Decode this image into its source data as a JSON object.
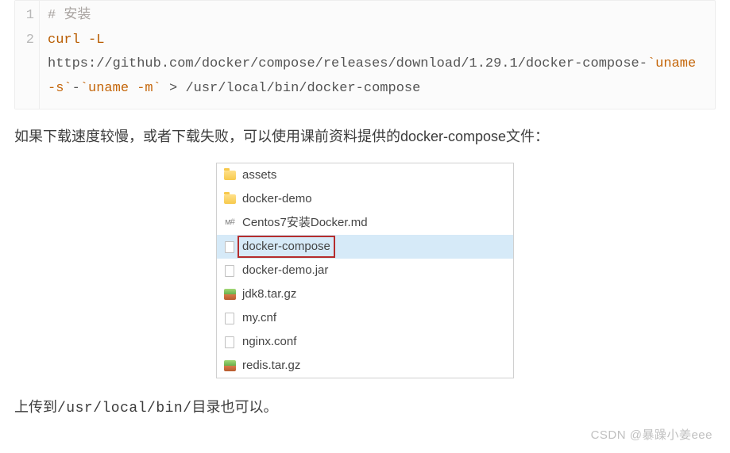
{
  "code": {
    "line_nums": [
      "1",
      "2"
    ],
    "comment": "# 安装",
    "cmd": "curl",
    "flag": "-L",
    "url": "https://github.com/docker/compose/releases/download/1.29.1/docker-compose-",
    "sub1": "`uname -s`",
    "dash": "-",
    "sub2": "`uname -m`",
    "redir": " > /usr/local/bin/docker-compose"
  },
  "para1": "如果下载速度较慢，或者下载失败，可以使用课前资料提供的docker-compose文件：",
  "files": {
    "items": [
      {
        "icon": "folder",
        "name": "assets"
      },
      {
        "icon": "folder",
        "name": "docker-demo"
      },
      {
        "icon": "md",
        "name": "Centos7安装Docker.md"
      },
      {
        "icon": "file",
        "name": "docker-compose",
        "selected": true
      },
      {
        "icon": "file",
        "name": "docker-demo.jar"
      },
      {
        "icon": "archive",
        "name": "jdk8.tar.gz"
      },
      {
        "icon": "file",
        "name": "my.cnf"
      },
      {
        "icon": "file",
        "name": "nginx.conf"
      },
      {
        "icon": "archive",
        "name": "redis.tar.gz"
      }
    ]
  },
  "para2_pre": "上传到",
  "para2_path": "/usr/local/bin/",
  "para2_post": "目录也可以。",
  "watermark": "CSDN @暴躁小姜eee"
}
